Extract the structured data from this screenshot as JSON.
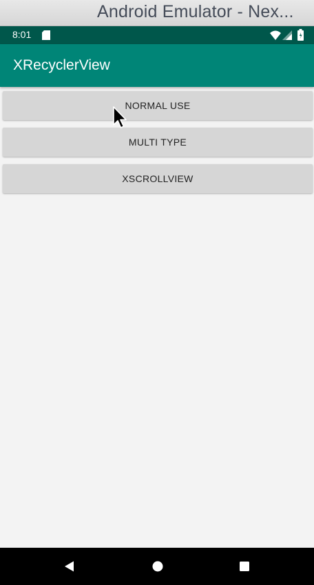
{
  "window": {
    "title": "Android Emulator - Nex..."
  },
  "status_bar": {
    "time": "8:01",
    "icons": [
      "sd-card-icon",
      "wifi-icon",
      "signal-icon",
      "battery-icon"
    ]
  },
  "app_bar": {
    "title": "XRecyclerView"
  },
  "buttons": [
    {
      "label": "NORMAL USE"
    },
    {
      "label": "MULTI TYPE"
    },
    {
      "label": "XSCROLLVIEW"
    }
  ],
  "nav_bar": {
    "icons": [
      "back-icon",
      "home-icon",
      "recents-icon"
    ]
  },
  "colors": {
    "status_bar": "#00574b",
    "app_bar": "#008577",
    "button_bg": "#d6d6d6",
    "content_bg": "#f3f3f3",
    "nav_bar": "#000000"
  }
}
